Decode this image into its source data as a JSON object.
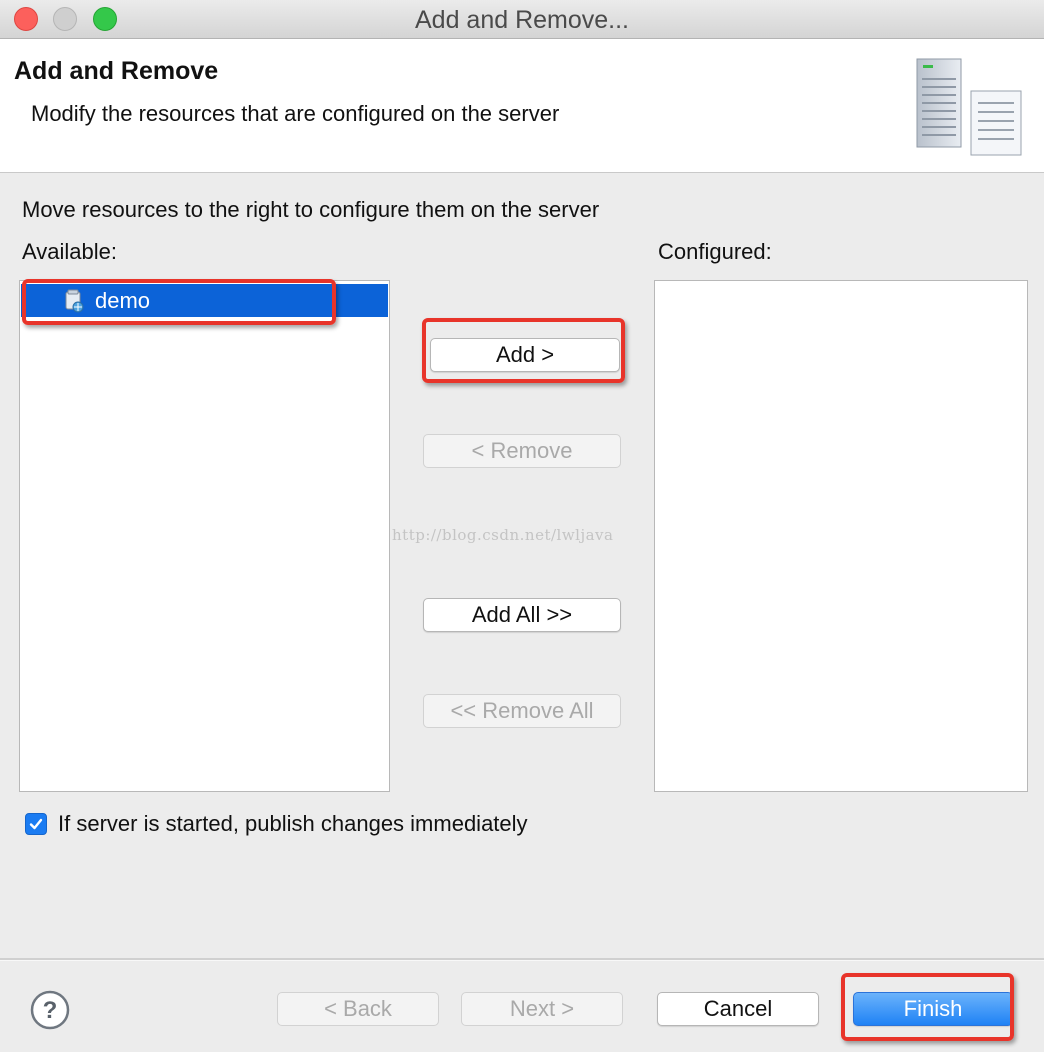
{
  "window": {
    "title": "Add and Remove..."
  },
  "header": {
    "title": "Add and Remove",
    "description": "Modify the resources that are configured on the server"
  },
  "instruction": "Move resources to the right to configure them on the server",
  "available": {
    "label": "Available:",
    "items": [
      {
        "label": "demo",
        "selected": true,
        "icon": "web-module-icon"
      }
    ]
  },
  "configured": {
    "label": "Configured:",
    "items": []
  },
  "buttons": {
    "add": "Add >",
    "remove": "< Remove",
    "add_all": "Add All >>",
    "remove_all": "<< Remove All"
  },
  "publish_option": {
    "label": "If server is started, publish changes immediately",
    "checked": true
  },
  "footer": {
    "back": "< Back",
    "next": "Next >",
    "cancel": "Cancel",
    "finish": "Finish"
  },
  "watermark": "http://blog.csdn.net/lwljava",
  "colors": {
    "selection": "#0c63d8",
    "highlight": "#e8342a",
    "finish": "#1f82f5"
  }
}
